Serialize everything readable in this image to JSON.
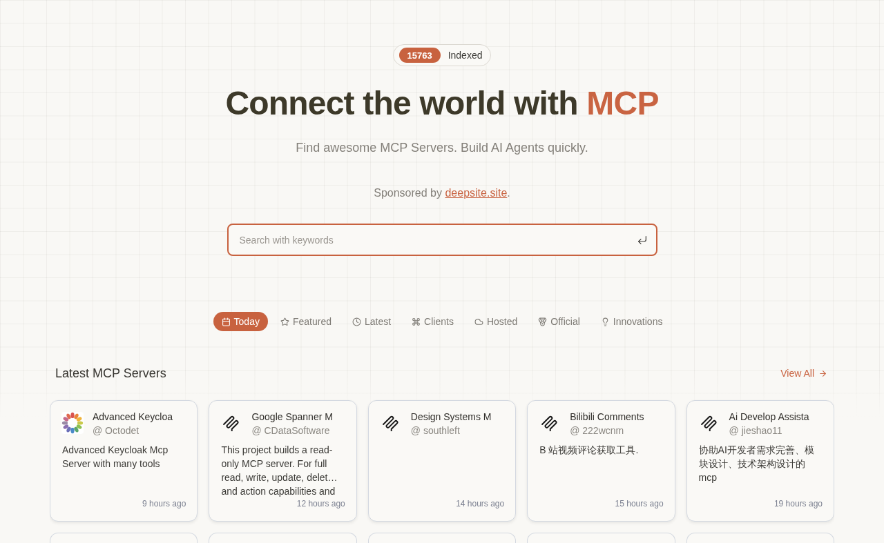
{
  "badge": {
    "count": "15763",
    "label": "Indexed"
  },
  "heading": {
    "text": "Connect the world with",
    "highlight": "MCP"
  },
  "subtitle": "Find awesome MCP Servers. Build AI Agents quickly.",
  "sponsor": {
    "prefix": "Sponsored by",
    "link": "deepsite.site",
    "suffix": "."
  },
  "search": {
    "placeholder": "Search with keywords"
  },
  "tabs": [
    {
      "label": "Today",
      "selected": true
    },
    {
      "label": "Featured",
      "selected": false
    },
    {
      "label": "Latest",
      "selected": false
    },
    {
      "label": "Clients",
      "selected": false
    },
    {
      "label": "Hosted",
      "selected": false
    },
    {
      "label": "Official",
      "selected": false
    },
    {
      "label": "Innovations",
      "selected": false
    }
  ],
  "section": {
    "title": "Latest MCP Servers",
    "link": "View All"
  },
  "servers": [
    {
      "kind": "custom",
      "title": "Advanced Keycloa",
      "author": "@ Octodet",
      "description": "Advanced Keycloak Mcp Server with many tools",
      "time": "9 hours ago"
    },
    {
      "kind": "default",
      "title": "Google Spanner M",
      "author": "@ CDataSoftware",
      "description": "This project builds a read-only MCP server. For full read, write, update, delet… and action capabilities and",
      "time": "12 hours ago"
    },
    {
      "kind": "default",
      "title": "Design Systems M",
      "author": "@ southleft",
      "time": "14 hours ago"
    },
    {
      "kind": "default",
      "title": "Bilibili Comments",
      "author": "@ 222wcnm",
      "description": "B 站视频评论获取工具.",
      "time": "15 hours ago"
    },
    {
      "kind": "default",
      "title": "Ai Develop Assista",
      "author": "@ jieshao11",
      "description": "协助AI开发者需求完善、模块设计、技术架构设计的mcp",
      "time": "19 hours ago"
    }
  ]
}
